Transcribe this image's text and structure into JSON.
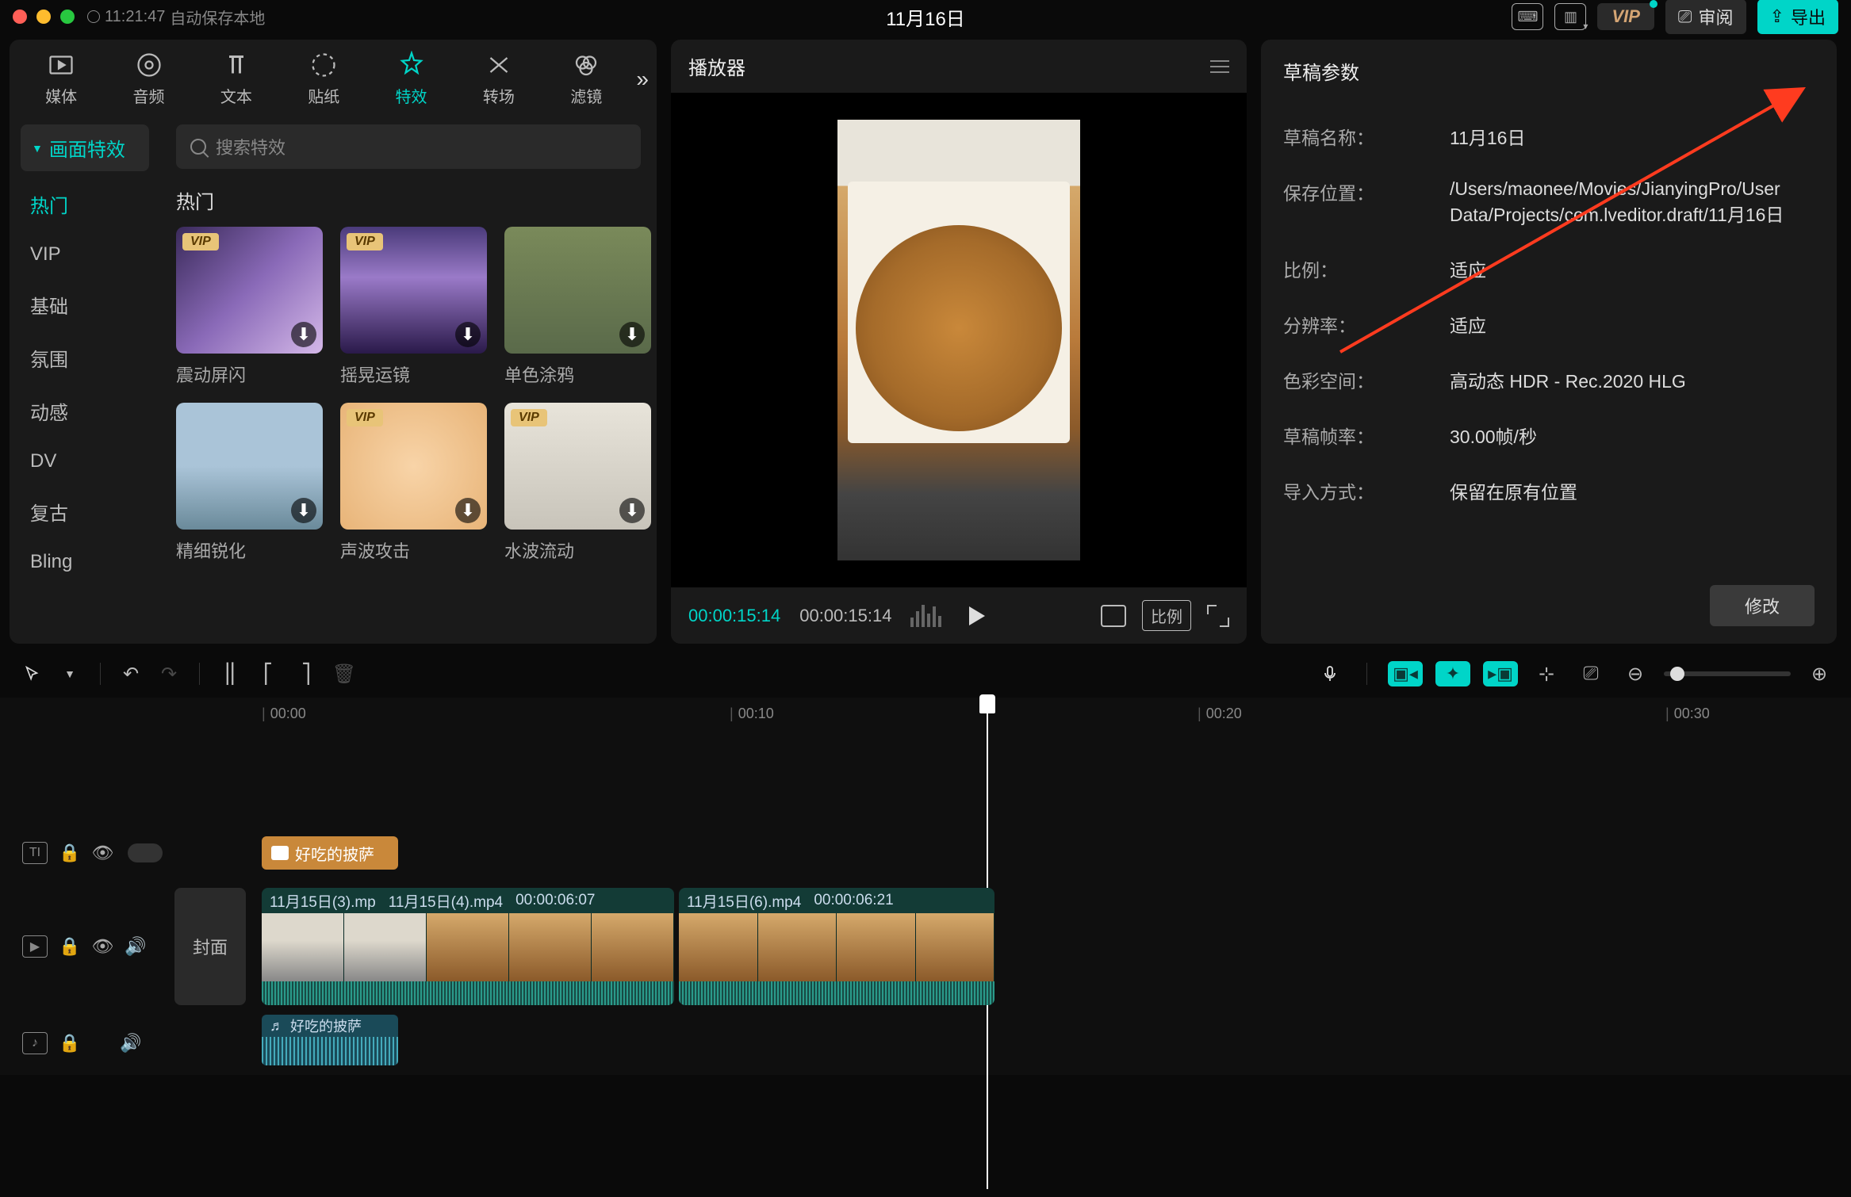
{
  "title_bar": {
    "time": "11:21:47",
    "autosave": "自动保存本地",
    "title": "11月16日",
    "vip": "VIP",
    "review": "审阅",
    "export": "导出"
  },
  "tabs": {
    "media": "媒体",
    "audio": "音频",
    "text": "文本",
    "sticker": "贴纸",
    "effect": "特效",
    "transition": "转场",
    "filter": "滤镜"
  },
  "categories": {
    "group": "画面特效",
    "items": [
      "热门",
      "VIP",
      "基础",
      "氛围",
      "动感",
      "DV",
      "复古",
      "Bling"
    ]
  },
  "search": {
    "placeholder": "搜索特效"
  },
  "effects_section": "热门",
  "effects": [
    {
      "name": "震动屏闪",
      "vip": true
    },
    {
      "name": "摇晃运镜",
      "vip": true
    },
    {
      "name": "单色涂鸦",
      "vip": false
    },
    {
      "name": "精细锐化",
      "vip": false
    },
    {
      "name": "声波攻击",
      "vip": true
    },
    {
      "name": "水波流动",
      "vip": true
    }
  ],
  "player": {
    "title": "播放器",
    "current": "00:00:15:14",
    "duration": "00:00:15:14",
    "ratio": "比例"
  },
  "params": {
    "title": "草稿参数",
    "name_label": "草稿名称：",
    "name_value": "11月16日",
    "path_label": "保存位置：",
    "path_value": "/Users/maonee/Movies/JianyingPro/User Data/Projects/com.lveditor.draft/11月16日",
    "ratio_label": "比例：",
    "ratio_value": "适应",
    "res_label": "分辨率：",
    "res_value": "适应",
    "color_label": "色彩空间：",
    "color_value": "高动态 HDR - Rec.2020 HLG",
    "fps_label": "草稿帧率：",
    "fps_value": "30.00帧/秒",
    "import_label": "导入方式：",
    "import_value": "保留在原有位置",
    "modify": "修改"
  },
  "ruler": {
    "t0": "00:00",
    "t10": "00:10",
    "t20": "00:20",
    "t30": "00:30"
  },
  "tracks": {
    "text_clip": "好吃的披萨",
    "cover": "封面",
    "video_clip1_name": "11月15日(3).mp",
    "video_clip2_name": "11月15日(4).mp4",
    "video_clip2_dur": "00:00:06:07",
    "video_clip3_name": "11月15日(6).mp4",
    "video_clip3_dur": "00:00:06:21",
    "audio_clip": "好吃的披萨"
  }
}
